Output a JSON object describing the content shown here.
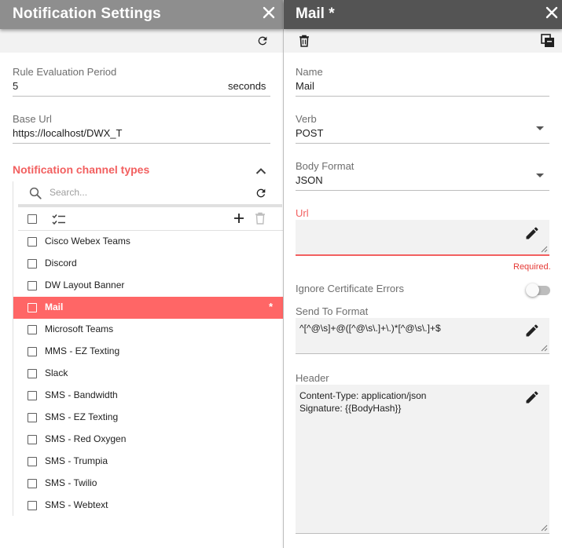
{
  "left": {
    "title": "Notification Settings",
    "rule_eval": {
      "label": "Rule Evaluation Period",
      "value": "5",
      "unit": "seconds"
    },
    "base_url": {
      "label": "Base Url",
      "value": "https://localhost/DWX_T"
    },
    "channel_types": {
      "title": "Notification channel types",
      "search_placeholder": "Search...",
      "items": [
        {
          "label": "Cisco Webex Teams",
          "selected": false
        },
        {
          "label": "Discord",
          "selected": false
        },
        {
          "label": "DW Layout Banner",
          "selected": false
        },
        {
          "label": "Mail",
          "selected": true,
          "modified_marker": "*"
        },
        {
          "label": "Microsoft Teams",
          "selected": false
        },
        {
          "label": "MMS - EZ Texting",
          "selected": false
        },
        {
          "label": "Slack",
          "selected": false
        },
        {
          "label": "SMS - Bandwidth",
          "selected": false
        },
        {
          "label": "SMS - EZ Texting",
          "selected": false
        },
        {
          "label": "SMS - Red Oxygen",
          "selected": false
        },
        {
          "label": "SMS - Trumpia",
          "selected": false
        },
        {
          "label": "SMS - Twilio",
          "selected": false
        },
        {
          "label": "SMS - Webtext",
          "selected": false
        }
      ]
    }
  },
  "right": {
    "title": "Mail *",
    "name": {
      "label": "Name",
      "value": "Mail"
    },
    "verb": {
      "label": "Verb",
      "value": "POST"
    },
    "body_format": {
      "label": "Body Format",
      "value": "JSON"
    },
    "url": {
      "label": "Url",
      "value": "",
      "error": "Required."
    },
    "ignore_cert": {
      "label": "Ignore Certificate Errors",
      "enabled": false
    },
    "send_to_format": {
      "label": "Send To Format",
      "value": "^[^@\\s]+@([^@\\s\\.]+\\.)*[^@\\s\\.]+$"
    },
    "header": {
      "label": "Header",
      "value": "Content-Type: application/json\nSignature: {{BodyHash}}"
    }
  },
  "icons": {
    "close": "close-icon",
    "refresh": "refresh-icon",
    "delete": "trash-icon",
    "copy": "copy-icon",
    "search": "search-icon",
    "add": "plus-icon",
    "checklist": "checklist-icon",
    "edit": "pencil-icon",
    "collapse": "chevron-up-icon"
  },
  "colors": {
    "accent": "#ff6666",
    "error": "#e53935",
    "left_header": "#8e8e8e",
    "right_header": "#545454"
  }
}
